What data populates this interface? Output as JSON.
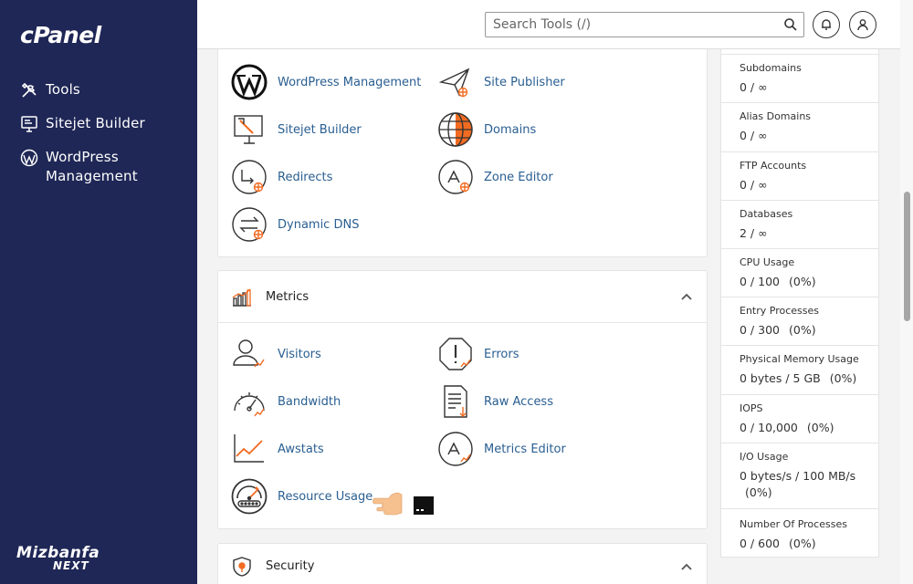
{
  "sidebar": {
    "logo": "cPanel",
    "nav": [
      {
        "label": "Tools"
      },
      {
        "label": "Sitejet Builder"
      },
      {
        "label": "WordPress Management"
      }
    ],
    "brand_line1": "Mizbanfa",
    "brand_line2": "NEXT"
  },
  "search": {
    "placeholder": "Search Tools (/)"
  },
  "domains_section": {
    "tools": [
      {
        "label": "WordPress Management"
      },
      {
        "label": "Site Publisher"
      },
      {
        "label": "Sitejet Builder"
      },
      {
        "label": "Domains"
      },
      {
        "label": "Redirects"
      },
      {
        "label": "Zone Editor"
      },
      {
        "label": "Dynamic DNS"
      }
    ]
  },
  "metrics_section": {
    "title": "Metrics",
    "tools": [
      {
        "label": "Visitors"
      },
      {
        "label": "Errors"
      },
      {
        "label": "Bandwidth"
      },
      {
        "label": "Raw Access"
      },
      {
        "label": "Awstats"
      },
      {
        "label": "Metrics Editor"
      },
      {
        "label": "Resource Usage"
      }
    ]
  },
  "security_section": {
    "title": "Security"
  },
  "stats": [
    {
      "label": "Subdomains",
      "value": "0 / ∞",
      "pct": ""
    },
    {
      "label": "Alias Domains",
      "value": "0 / ∞",
      "pct": ""
    },
    {
      "label": "FTP Accounts",
      "value": "0 / ∞",
      "pct": ""
    },
    {
      "label": "Databases",
      "value": "2 / ∞",
      "pct": ""
    },
    {
      "label": "CPU Usage",
      "value": "0 / 100",
      "pct": "(0%)"
    },
    {
      "label": "Entry Processes",
      "value": "0 / 300",
      "pct": "(0%)"
    },
    {
      "label": "Physical Memory Usage",
      "value": "0 bytes / 5 GB",
      "pct": "(0%)"
    },
    {
      "label": "IOPS",
      "value": "0 / 10,000",
      "pct": "(0%)"
    },
    {
      "label": "I/O Usage",
      "value": "0 bytes/s / 100 MB/s",
      "pct": "(0%)"
    },
    {
      "label": "Number Of Processes",
      "value": "0 / 600",
      "pct": "(0%)"
    }
  ],
  "colors": {
    "sidebar": "#1f2756",
    "link": "#295e91",
    "accent": "#f26b21"
  }
}
